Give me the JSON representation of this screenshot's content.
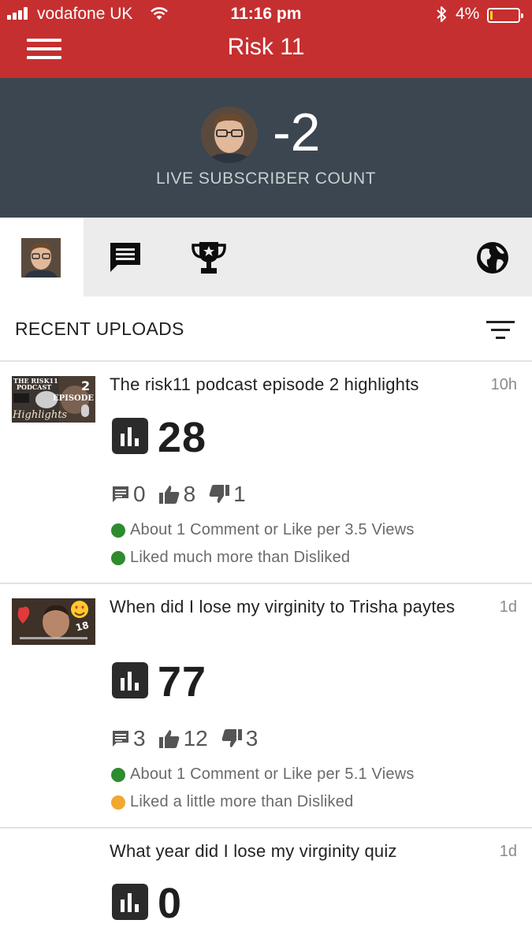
{
  "status_bar": {
    "carrier": "vodafone UK",
    "time": "11:16 pm",
    "battery": "4%",
    "battery_level": 0.04
  },
  "app_bar": {
    "title": "Risk 11"
  },
  "subscriber": {
    "count": "-2",
    "label": "LIVE SUBSCRIBER COUNT"
  },
  "tabs": [
    {
      "name": "channel",
      "icon": "channel-avatar"
    },
    {
      "name": "comments",
      "icon": "comment-icon"
    },
    {
      "name": "achievements",
      "icon": "trophy-icon"
    },
    {
      "name": "world",
      "icon": "globe-icon"
    }
  ],
  "section": {
    "title": "RECENT UPLOADS",
    "filter_icon": "filter-icon"
  },
  "uploads": [
    {
      "title": "The risk11 podcast episode 2 highlights",
      "age": "10h",
      "views": "28",
      "comments": "0",
      "likes": "8",
      "dislikes": "1",
      "engagement": "About 1 Comment or Like per 3.5 Views",
      "engagement_color": "#2e8b2e",
      "sentiment": "Liked much more than Disliked",
      "sentiment_color": "#2e8b2e",
      "thumb_text": [
        "THE RISK11",
        "PODCAST",
        "2",
        "EPISODE",
        "Highlights"
      ]
    },
    {
      "title": "When did I lose my virginity to Trisha paytes",
      "age": "1d",
      "views": "77",
      "comments": "3",
      "likes": "12",
      "dislikes": "3",
      "engagement": "About 1 Comment or Like per 5.1 Views",
      "engagement_color": "#2e8b2e",
      "sentiment": "Liked a little more than Disliked",
      "sentiment_color": "#f0a830",
      "thumb_text": [
        "18"
      ]
    },
    {
      "title": "What  year did I lose my virginity quiz",
      "age": "1d",
      "views": "0"
    }
  ],
  "colors": {
    "app_bar": "#c62f2f",
    "header": "#3b4650",
    "tab_bar": "#ececec"
  }
}
